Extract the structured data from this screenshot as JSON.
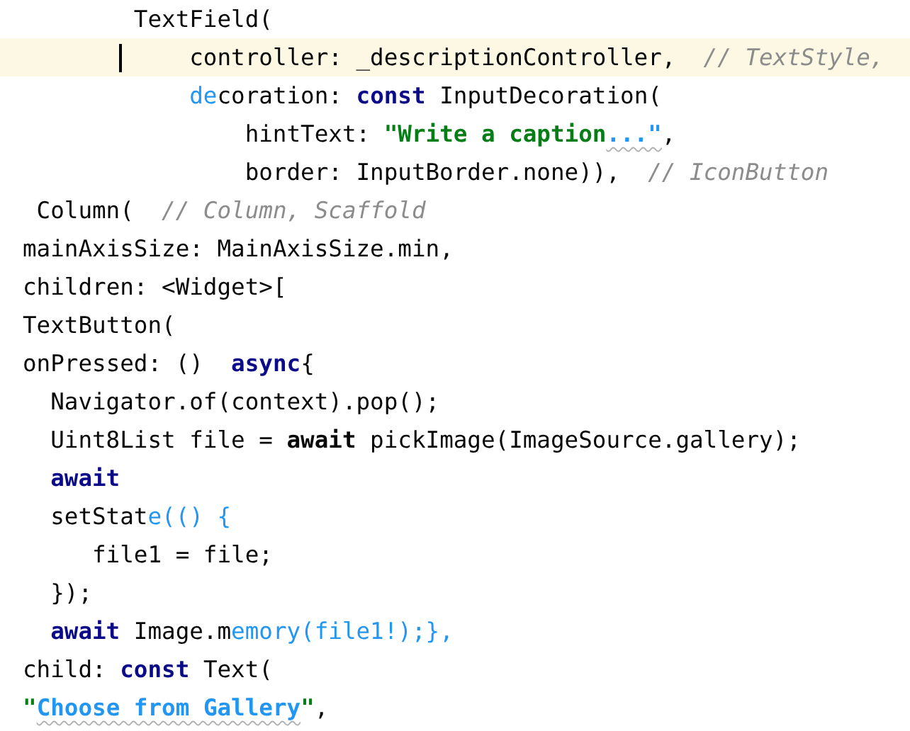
{
  "editor": {
    "lines": [
      {
        "kind": "large",
        "tokens": [
          {
            "kind": "plain",
            "text": "TextField("
          }
        ]
      },
      {
        "kind": "larger",
        "current": true,
        "tokens": [
          {
            "kind": "plain",
            "text": "controller: _descriptionController,"
          },
          {
            "kind": "comment",
            "text": "  // TextStyle,"
          }
        ]
      },
      {
        "kind": "larger",
        "tokens": [
          {
            "kind": "match",
            "text": "de"
          },
          {
            "kind": "plain",
            "text": "coration: "
          },
          {
            "kind": "keyword",
            "text": "const"
          },
          {
            "kind": "plain",
            "text": " InputDecoration("
          }
        ]
      },
      {
        "kind": "largest",
        "tokens": [
          {
            "kind": "plain",
            "text": "hintText: "
          },
          {
            "kind": "string",
            "text": "\"Write a caption"
          },
          {
            "kind": "match",
            "text": "...\"",
            "typo": true
          },
          {
            "kind": "plain",
            "text": ","
          }
        ]
      },
      {
        "kind": "largest",
        "tokens": [
          {
            "kind": "plain",
            "text": "border: InputBorder.none)),"
          },
          {
            "kind": "comment",
            "text": "  // IconButton"
          }
        ]
      },
      {
        "kind": "tiny",
        "tokens": [
          {
            "kind": "plain",
            "text": "Column("
          },
          {
            "kind": "comment",
            "text": "  // Column, Scaffold"
          }
        ]
      },
      {
        "kind": "flush",
        "tokens": [
          {
            "kind": "plain",
            "text": "mainAxisSize: MainAxisSize.min,"
          }
        ]
      },
      {
        "kind": "flush",
        "tokens": [
          {
            "kind": "plain",
            "text": "children: <Widget>["
          }
        ]
      },
      {
        "kind": "flush",
        "tokens": [
          {
            "kind": "plain",
            "text": "TextButton("
          }
        ]
      },
      {
        "kind": "flush",
        "tokens": [
          {
            "kind": "plain",
            "text": "onPressed: ()  "
          },
          {
            "kind": "keyword",
            "text": "async"
          },
          {
            "kind": "plain",
            "text": "{"
          }
        ]
      },
      {
        "kind": "small",
        "tokens": [
          {
            "kind": "plain",
            "text": "Navigator.of(context).pop();"
          }
        ]
      },
      {
        "kind": "small",
        "tokens": [
          {
            "kind": "plain",
            "text": "Uint8List file = "
          },
          {
            "kind": "bold",
            "text": "await"
          },
          {
            "kind": "plain",
            "text": " pickImage(ImageSource.gallery);"
          }
        ]
      },
      {
        "kind": "small",
        "tokens": [
          {
            "kind": "keyword",
            "text": "await"
          }
        ]
      },
      {
        "kind": "small",
        "tokens": [
          {
            "kind": "plain",
            "text": "setStat"
          },
          {
            "kind": "match",
            "text": "e(() {"
          }
        ]
      },
      {
        "kind": "medium",
        "tokens": [
          {
            "kind": "plain",
            "text": "file1 = file;"
          }
        ]
      },
      {
        "kind": "small",
        "tokens": [
          {
            "kind": "plain",
            "text": "});"
          }
        ]
      },
      {
        "kind": "small",
        "tokens": [
          {
            "kind": "keyword",
            "text": "await"
          },
          {
            "kind": "plain",
            "text": " Image.m"
          },
          {
            "kind": "match",
            "text": "emory(file1!);},"
          }
        ]
      },
      {
        "kind": "flush",
        "tokens": [
          {
            "kind": "plain",
            "text": "child: "
          },
          {
            "kind": "keyword",
            "text": "const"
          },
          {
            "kind": "plain",
            "text": " Text("
          }
        ]
      },
      {
        "kind": "flush",
        "tokens": [
          {
            "kind": "string",
            "text": "\""
          },
          {
            "kind": "match",
            "text": "Choose from Gallery",
            "typo": true
          },
          {
            "kind": "string",
            "text": "\""
          },
          {
            "kind": "plain",
            "text": ","
          }
        ]
      }
    ]
  }
}
